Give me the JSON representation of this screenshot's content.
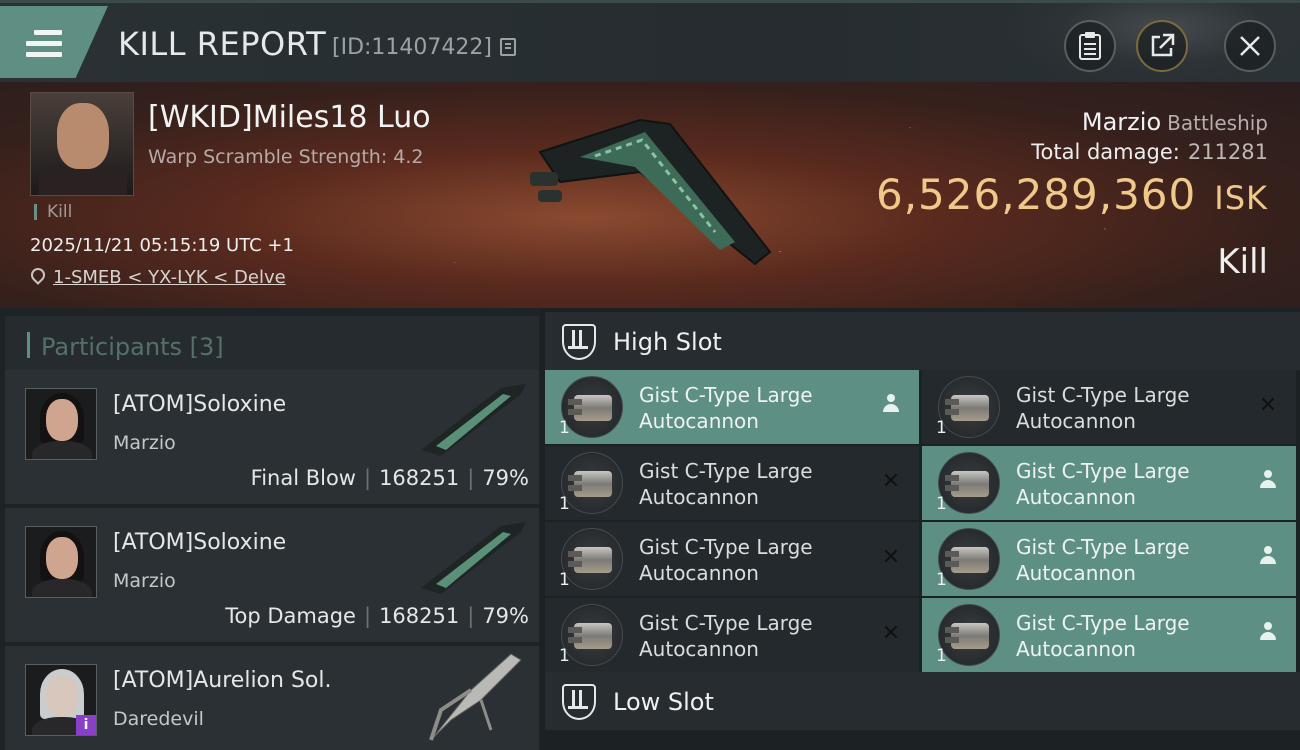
{
  "header": {
    "title": "KILL REPORT",
    "report_id": "[ID:11407422]"
  },
  "victim": {
    "name": "[WKID]Miles18 Luo",
    "stat": "Warp Scramble Strength: 4.2",
    "kill_tag": "Kill",
    "datetime": "2025/11/21 05:15:19 UTC +1",
    "location": "1-SMEB < YX-LYK < Delve",
    "ship_name": "Marzio",
    "ship_class": "Battleship",
    "total_damage_label": "Total damage:",
    "total_damage": "211281",
    "isk_value": "6,526,289,360",
    "isk_unit": "ISK",
    "result": "Kill"
  },
  "participants": {
    "label": "Participants",
    "count": "[3]",
    "items": [
      {
        "name": "[ATOM]Soloxine",
        "ship": "Marzio",
        "role": "Final Blow",
        "damage": "168251",
        "percent": "79%"
      },
      {
        "name": "[ATOM]Soloxine",
        "ship": "Marzio",
        "role": "Top Damage",
        "damage": "168251",
        "percent": "79%"
      },
      {
        "name": "[ATOM]Aurelion Sol.",
        "ship": "Daredevil",
        "badge": "i"
      }
    ]
  },
  "slots": {
    "high": {
      "label": "High Slot",
      "items": [
        {
          "name": "Gist C-Type Large Autocannon",
          "qty": "1",
          "state": "dropped"
        },
        {
          "name": "Gist C-Type Large Autocannon",
          "qty": "1",
          "state": "destroyed"
        },
        {
          "name": "Gist C-Type Large Autocannon",
          "qty": "1",
          "state": "destroyed"
        },
        {
          "name": "Gist C-Type Large Autocannon",
          "qty": "1",
          "state": "dropped"
        },
        {
          "name": "Gist C-Type Large Autocannon",
          "qty": "1",
          "state": "destroyed"
        },
        {
          "name": "Gist C-Type Large Autocannon",
          "qty": "1",
          "state": "dropped"
        },
        {
          "name": "Gist C-Type Large Autocannon",
          "qty": "1",
          "state": "destroyed"
        },
        {
          "name": "Gist C-Type Large Autocannon",
          "qty": "1",
          "state": "dropped"
        }
      ]
    },
    "low": {
      "label": "Low Slot"
    }
  },
  "icons": {
    "menu": "menu-icon",
    "copy": "copy-icon",
    "clipboard": "clipboard-icon",
    "share": "share-icon",
    "close": "close-icon",
    "location": "location-pin-icon",
    "slot": "slot-shield-icon",
    "destroyed": "x-mark-icon",
    "dropped": "person-icon"
  },
  "colors": {
    "accent": "#5e8f85",
    "isk": "#f0c98a"
  }
}
